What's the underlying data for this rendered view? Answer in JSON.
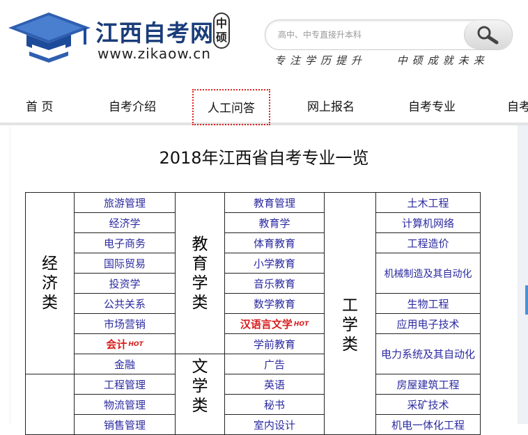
{
  "header": {
    "brand": "江西自考网",
    "domain": "www.zikaow.cn",
    "seal": [
      "中",
      "硕"
    ],
    "search_placeholder": "高中、中专直接升本科",
    "slogan_left": "专注学历提升",
    "slogan_right": "中硕成就未来"
  },
  "nav": [
    "首 页",
    "自考介绍",
    "人工问答",
    "网上报名",
    "自考专业",
    "自考"
  ],
  "page": {
    "title": "2018年江西省自考专业一览",
    "hot_badge": "HOT"
  },
  "table": {
    "cat_economics": "经济类",
    "cat_education": "教育学类",
    "cat_literature": "文学类",
    "cat_engineering": "工学类",
    "economics": [
      "旅游管理",
      "经济学",
      "电子商务",
      "国际贸易",
      "投资学",
      "公共关系",
      "市场营销",
      "会计",
      "金融"
    ],
    "management": [
      "工程管理",
      "物流管理",
      "销售管理"
    ],
    "education": [
      "教育管理",
      "教育学",
      "体育教育",
      "小学教育",
      "音乐教育",
      "数学教育",
      "汉语言文学",
      "学前教育"
    ],
    "literature": [
      "广告",
      "英语",
      "秘书",
      "室内设计"
    ],
    "engineering": [
      "土木工程",
      "计算机网络",
      "工程造价",
      "机械制造及其自动化",
      "生物工程",
      "应用电子技术",
      "电力系统及其自动化",
      "房屋建筑工程",
      "采矿技术",
      "机电一体化工程"
    ]
  },
  "colors": {
    "brand": "#1a3c7a",
    "link": "#2b2aa0",
    "hot": "#d91c1c",
    "active_border": "#dd2222"
  }
}
